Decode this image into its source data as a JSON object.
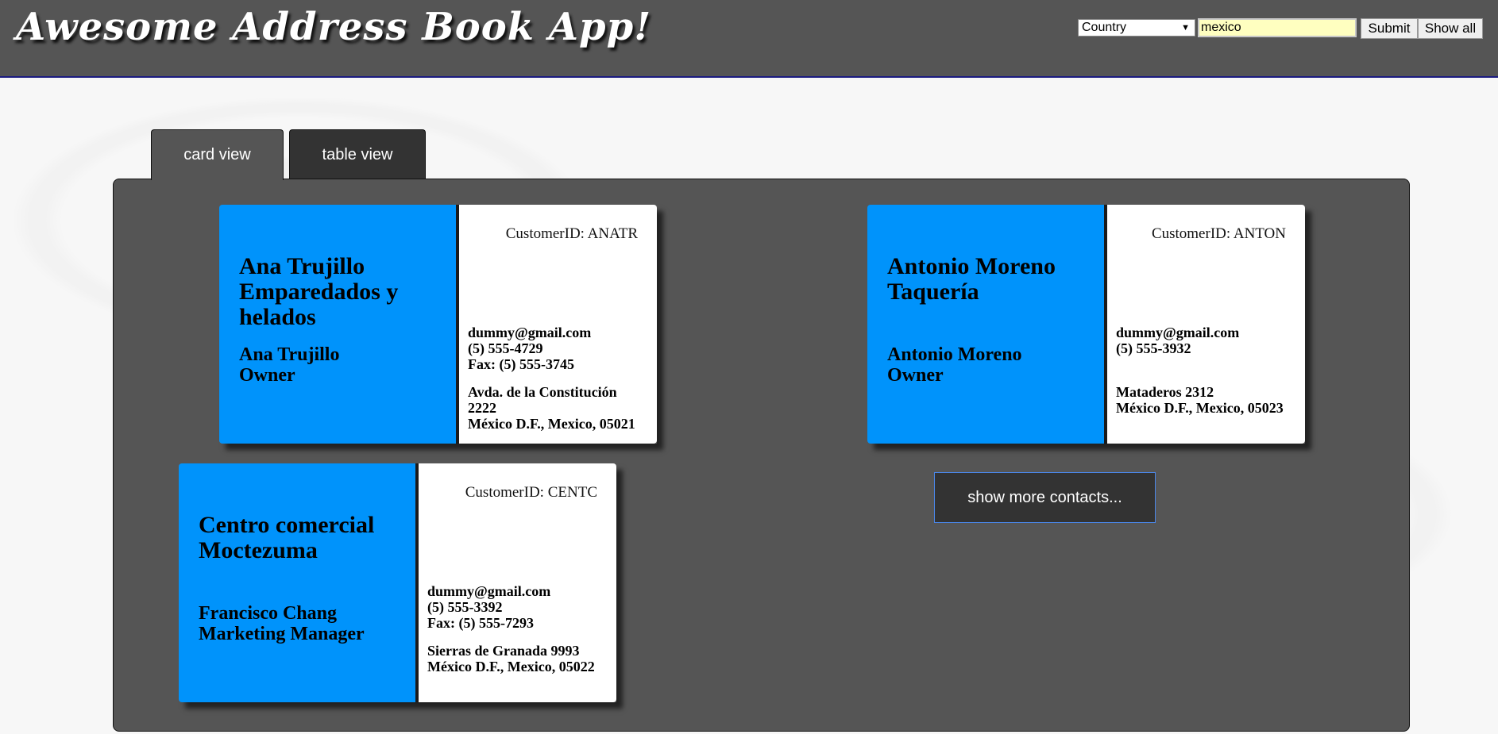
{
  "app": {
    "title": "Awesome Address Book App!"
  },
  "search": {
    "field_select": "Country",
    "query": "mexico",
    "submit_label": "Submit",
    "show_all_label": "Show all"
  },
  "tabs": [
    {
      "label": "card view",
      "active": true
    },
    {
      "label": "table view",
      "active": false
    }
  ],
  "cards": [
    {
      "company": "Ana Trujillo Emparedados y helados",
      "contact_name": "Ana Trujillo",
      "contact_title": "Owner",
      "customer_id": "CustomerID: ANATR",
      "email": "dummy@gmail.com",
      "phone": "(5) 555-4729",
      "fax": "Fax: (5) 555-3745",
      "address_line": "Avda. de la Constitución 2222",
      "city_line": "México D.F., Mexico, 05021"
    },
    {
      "company": "Antonio Moreno Taquería",
      "contact_name": "Antonio Moreno",
      "contact_title": "Owner",
      "customer_id": "CustomerID: ANTON",
      "email": "dummy@gmail.com",
      "phone": "(5) 555-3932",
      "fax": "",
      "address_line": "Mataderos 2312",
      "city_line": "México D.F., Mexico, 05023"
    },
    {
      "company": "Centro comercial Moctezuma",
      "contact_name": "Francisco Chang",
      "contact_title": "Marketing Manager",
      "customer_id": "CustomerID: CENTC",
      "email": "dummy@gmail.com",
      "phone": "(5) 555-3392",
      "fax": "Fax: (5) 555-7293",
      "address_line": "Sierras de Granada 9993",
      "city_line": "México D.F., Mexico, 05022"
    }
  ],
  "more_button": {
    "label": "show more contacts..."
  },
  "colors": {
    "header_bg": "#555555",
    "card_accent": "#0093fb",
    "search_input_bg": "#ffffc0",
    "button_dark": "#333333"
  }
}
